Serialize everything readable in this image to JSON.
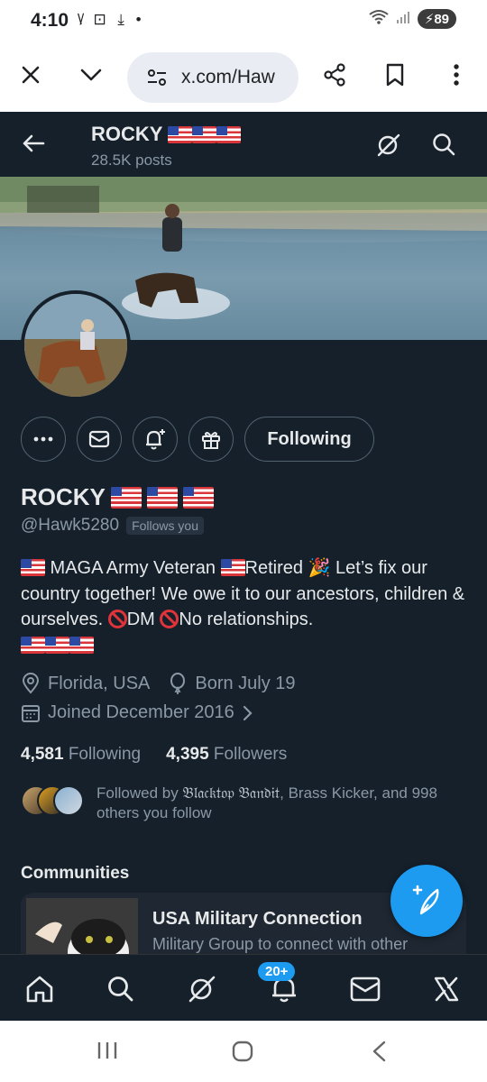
{
  "status": {
    "time": "4:10",
    "battery": "89"
  },
  "browser": {
    "url": "x.com/Haw"
  },
  "header": {
    "name": "ROCKY",
    "posts": "28.5K posts"
  },
  "profile": {
    "name": "ROCKY",
    "handle": "@Hawk5280",
    "follows_you": "Follows you",
    "action_following": "Following",
    "bio": {
      "seg1": " MAGA Army Veteran ",
      "seg2": "Retired ",
      "seg3": " Let’s fix our country together! We owe it to our ancestors, children & ourselves. ",
      "seg4": "DM ",
      "seg5": "No relationships."
    },
    "location": "Florida, USA",
    "born": "Born July 19",
    "joined": "Joined December 2016",
    "following_count": "4,581",
    "following_label": "Following",
    "followers_count": "4,395",
    "followers_label": "Followers",
    "followed_by_prefix": "Followed by ",
    "followed_by_name": "𝔅𝔩𝔞𝔠𝔨𝔱𝔬𝔭 𝔅𝔞𝔫𝔡𝔦𝔱",
    "followed_by_suffix": ", Brass Kicker, and 998 others you follow"
  },
  "communities": {
    "heading": "Communities",
    "items": [
      {
        "title": "USA Military Connection",
        "desc": "Military Group to connect with other"
      }
    ]
  },
  "nav": {
    "notifications_badge": "20+"
  },
  "colors": {
    "bg": "#15202b",
    "accent": "#1d9bf0",
    "muted": "#8b98a5",
    "text": "#e7e9ea"
  }
}
